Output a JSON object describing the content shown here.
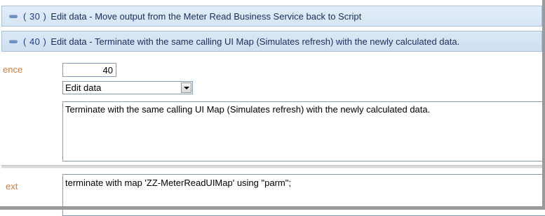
{
  "steps": [
    {
      "sequence_display": "( 30 )",
      "text": "Edit data - Move output from the Meter Read Business Service back to Script"
    },
    {
      "sequence_display": "( 40 )",
      "text": "Edit data - Terminate with the same calling UI Map (Simulates refresh) with the newly calculated data."
    }
  ],
  "detail": {
    "sequence_label": "ence",
    "sequence_value": "40",
    "step_type_selected": "Edit data",
    "description": "Terminate with the same calling UI Map (Simulates refresh) with the newly calculated data.",
    "script_label": "ext",
    "script_text": "terminate with map 'ZZ-MeterReadUIMap' using \"parm\";"
  },
  "icons": {
    "collapse": "collapse-icon",
    "dropdown": "chevron-down-icon"
  },
  "colors": {
    "row_background": "#d6e5f4",
    "label_color": "#d07c3a",
    "field_border": "#7f9db9"
  }
}
